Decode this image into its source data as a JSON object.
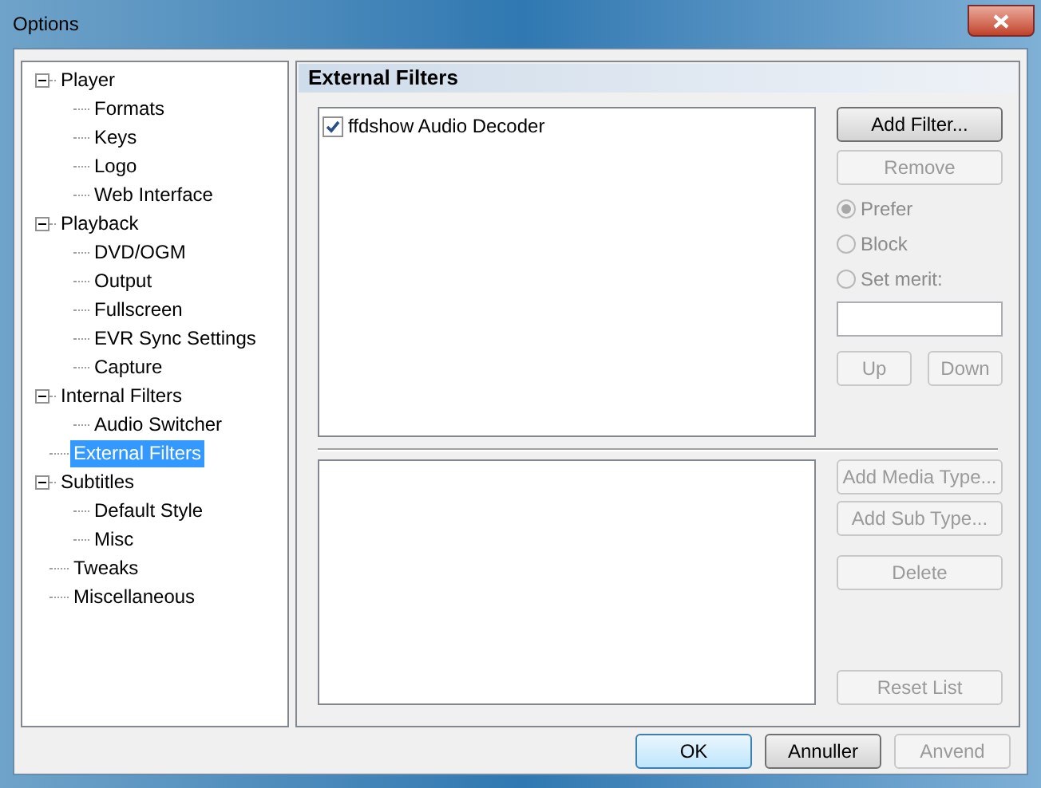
{
  "window": {
    "title": "Options"
  },
  "tree": [
    {
      "label": "Player",
      "expanded": true,
      "selected": false,
      "children": [
        {
          "label": "Formats",
          "selected": false
        },
        {
          "label": "Keys",
          "selected": false
        },
        {
          "label": "Logo",
          "selected": false
        },
        {
          "label": "Web Interface",
          "selected": false
        }
      ]
    },
    {
      "label": "Playback",
      "expanded": true,
      "selected": false,
      "children": [
        {
          "label": "DVD/OGM",
          "selected": false
        },
        {
          "label": "Output",
          "selected": false
        },
        {
          "label": "Fullscreen",
          "selected": false
        },
        {
          "label": "EVR Sync Settings",
          "selected": false
        },
        {
          "label": "Capture",
          "selected": false
        }
      ]
    },
    {
      "label": "Internal Filters",
      "expanded": true,
      "selected": false,
      "children": [
        {
          "label": "Audio Switcher",
          "selected": false
        }
      ]
    },
    {
      "label": "External Filters",
      "selected": true
    },
    {
      "label": "Subtitles",
      "expanded": true,
      "selected": false,
      "children": [
        {
          "label": "Default Style",
          "selected": false
        },
        {
          "label": "Misc",
          "selected": false
        }
      ]
    },
    {
      "label": "Tweaks",
      "selected": false
    },
    {
      "label": "Miscellaneous",
      "selected": false
    }
  ],
  "page_title": "External Filters",
  "filters": [
    {
      "label": "ffdshow Audio Decoder",
      "checked": true
    }
  ],
  "filter_buttons": [
    {
      "label": "Add Filter...",
      "disabled": false
    },
    {
      "label": "Remove",
      "disabled": true
    }
  ],
  "merit_options": [
    {
      "label": "Prefer",
      "selected": true,
      "disabled": true
    },
    {
      "label": "Block",
      "selected": false,
      "disabled": true
    },
    {
      "label": "Set merit:",
      "selected": false,
      "disabled": true
    }
  ],
  "order_buttons": [
    {
      "label": "Up",
      "disabled": true
    },
    {
      "label": "Down",
      "disabled": true
    }
  ],
  "type_buttons": [
    {
      "label": "Add Media Type...",
      "disabled": true
    },
    {
      "label": "Add Sub Type...",
      "disabled": true
    },
    {
      "label": "Delete",
      "disabled": true
    }
  ],
  "reset_button": {
    "label": "Reset List",
    "disabled": true
  },
  "dialog_buttons": [
    {
      "label": "OK",
      "default": true,
      "disabled": false
    },
    {
      "label": "Annuller",
      "default": false,
      "disabled": false
    },
    {
      "label": "Anvend",
      "default": false,
      "disabled": true
    }
  ]
}
